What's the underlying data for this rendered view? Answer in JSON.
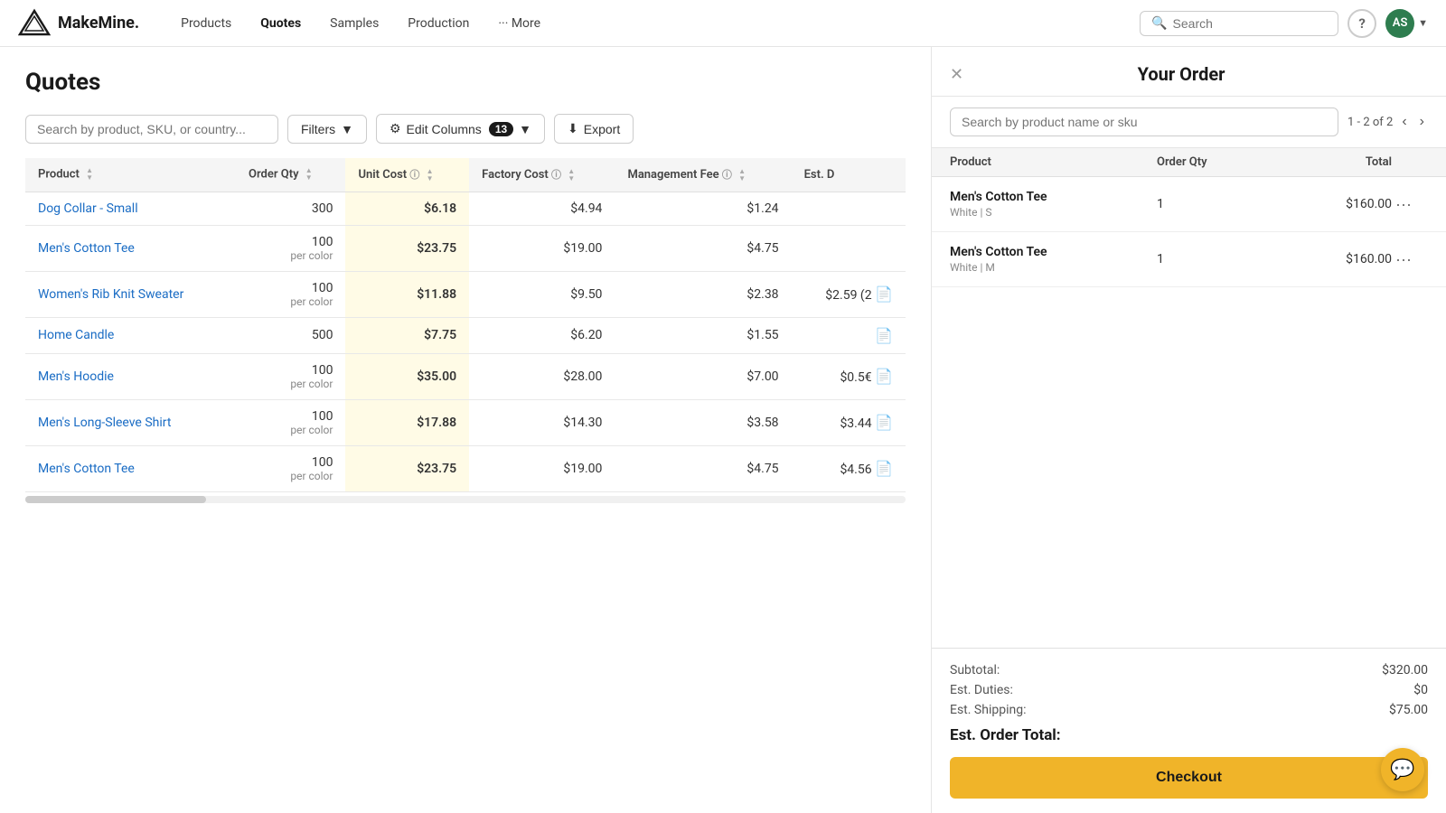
{
  "nav": {
    "logo_text": "MakeMine.",
    "links": [
      {
        "label": "Products",
        "active": false
      },
      {
        "label": "Quotes",
        "active": true
      },
      {
        "label": "Samples",
        "active": false
      },
      {
        "label": "Production",
        "active": false
      },
      {
        "label": "··· More",
        "active": false
      }
    ],
    "search_placeholder": "Search",
    "avatar_initials": "AS"
  },
  "page": {
    "title": "Quotes",
    "search_placeholder": "Search by product, SKU, or country...",
    "filter_label": "Filters",
    "edit_columns_label": "Edit Columns",
    "edit_columns_count": "13",
    "export_label": "Export"
  },
  "table": {
    "columns": [
      {
        "label": "Product",
        "key": "product"
      },
      {
        "label": "Order Qty",
        "key": "order_qty"
      },
      {
        "label": "Unit Cost",
        "key": "unit_cost",
        "info": true
      },
      {
        "label": "Factory Cost",
        "key": "factory_cost",
        "info": true
      },
      {
        "label": "Management Fee",
        "key": "management_fee",
        "info": true
      },
      {
        "label": "Est. D",
        "key": "est_d"
      }
    ],
    "rows": [
      {
        "product": "Dog Collar - Small",
        "order_qty": "300",
        "qty_sub": "",
        "unit_cost": "$6.18",
        "factory_cost": "$4.94",
        "management_fee": "$1.24",
        "est_d": "",
        "has_doc": false
      },
      {
        "product": "Men's Cotton Tee",
        "order_qty": "100",
        "qty_sub": "per color",
        "unit_cost": "$23.75",
        "factory_cost": "$19.00",
        "management_fee": "$4.75",
        "est_d": "",
        "has_doc": false
      },
      {
        "product": "Women's Rib Knit Sweater",
        "order_qty": "100",
        "qty_sub": "per color",
        "unit_cost": "$11.88",
        "factory_cost": "$9.50",
        "management_fee": "$2.38",
        "est_d": "$2.59 (2",
        "has_doc": true
      },
      {
        "product": "Home Candle",
        "order_qty": "500",
        "qty_sub": "",
        "unit_cost": "$7.75",
        "factory_cost": "$6.20",
        "management_fee": "$1.55",
        "est_d": "",
        "has_doc": true
      },
      {
        "product": "Men's Hoodie",
        "order_qty": "100",
        "qty_sub": "per color",
        "unit_cost": "$35.00",
        "factory_cost": "$28.00",
        "management_fee": "$7.00",
        "est_d": "$0.5€",
        "has_doc": true
      },
      {
        "product": "Men's Long-Sleeve Shirt",
        "order_qty": "100",
        "qty_sub": "per color",
        "unit_cost": "$17.88",
        "factory_cost": "$14.30",
        "management_fee": "$3.58",
        "est_d": "$3.44",
        "has_doc": true
      },
      {
        "product": "Men's Cotton Tee",
        "order_qty": "100",
        "qty_sub": "per color",
        "unit_cost": "$23.75",
        "factory_cost": "$19.00",
        "management_fee": "$4.75",
        "est_d": "$4.56",
        "has_doc": true
      }
    ]
  },
  "order_panel": {
    "title": "Your Order",
    "search_placeholder": "Search by product name or sku",
    "pagination": "1 - 2 of 2",
    "columns": {
      "product": "Product",
      "order_qty": "Order Qty",
      "total": "Total"
    },
    "items": [
      {
        "name": "Men's Cotton Tee",
        "variant": "White | S",
        "qty": "1",
        "total": "$160.00"
      },
      {
        "name": "Men's Cotton Tee",
        "variant": "White | M",
        "qty": "1",
        "total": "$160.00"
      }
    ],
    "summary": {
      "subtotal_label": "Subtotal:",
      "subtotal_value": "$320.00",
      "duties_label": "Est. Duties:",
      "duties_value": "$0",
      "shipping_label": "Est. Shipping:",
      "shipping_value": "$75.00",
      "total_label": "Est. Order Total:",
      "total_value": ""
    },
    "checkout_label": "Checkout"
  }
}
